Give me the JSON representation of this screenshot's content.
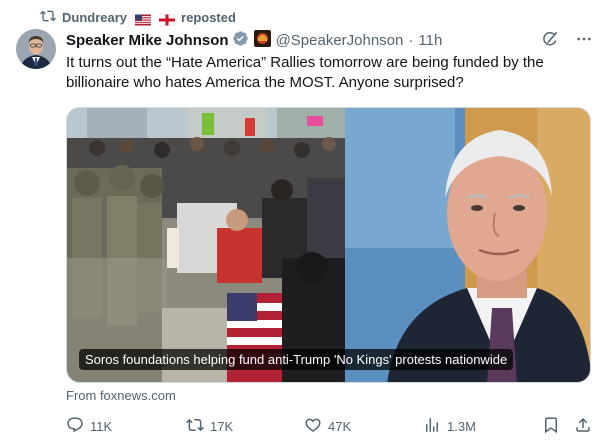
{
  "repost": {
    "user": "Dundreary",
    "label": "reposted",
    "icon": "repost-icon"
  },
  "tweet": {
    "author_name": "Speaker Mike Johnson",
    "handle": "@SpeakerJohnson",
    "separator": "·",
    "time": "11h",
    "text": "It turns out the “Hate America” Rallies tomorrow are being funded by the billionaire who hates America the MOST. Anyone surprised?",
    "media_caption": "Soros foundations helping fund anti-Trump 'No Kings' protests nationwide",
    "source": "From foxnews.com"
  },
  "metrics": {
    "replies": "11K",
    "reposts": "17K",
    "likes": "47K",
    "views": "1.3M"
  },
  "colors": {
    "text": "#0f1419",
    "muted": "#536471",
    "verified": "#829aab",
    "border": "#cfd9de"
  }
}
